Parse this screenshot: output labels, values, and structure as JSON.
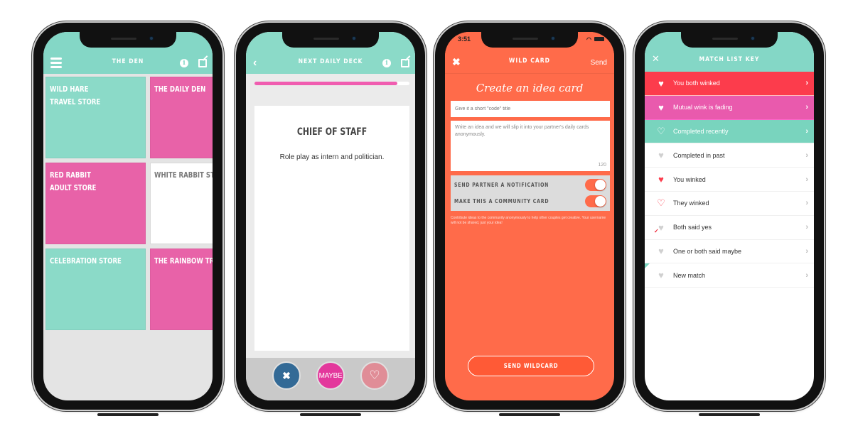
{
  "colors": {
    "teal": "#84d7c6",
    "pink": "#e862a8",
    "coral": "#ff6b4a",
    "red": "#fc3c4c",
    "magenta": "#e95aad",
    "mint": "#79d4be",
    "progress": "#f05db0",
    "no_button": "#336a96",
    "maybe_button": "#e3389c",
    "yes_button": "#e08d97"
  },
  "phone1": {
    "title": "The Den",
    "tiles": [
      {
        "label_lines": [
          "Wild Hare",
          "Travel Store"
        ],
        "color": "teal"
      },
      {
        "label_lines": [
          "The Daily Den"
        ],
        "color": "pink"
      },
      {
        "label_lines": [
          "Red Rabbit",
          "Adult Store"
        ],
        "color": "pink"
      },
      {
        "label_lines": [
          "White Rabbit Store"
        ],
        "color": "white"
      },
      {
        "label_lines": [
          "Celebration Store"
        ],
        "color": "teal"
      },
      {
        "label_lines": [
          "The Rainbow Trail"
        ],
        "color": "pink"
      }
    ]
  },
  "phone2": {
    "title": "Next Daily Deck",
    "progress_percent": 92,
    "card_title": "Chief of Staff",
    "card_text": "Role play as intern and politician.",
    "buttons": {
      "no": "✖",
      "maybe": "MAYBE",
      "yes": "♡"
    }
  },
  "phone3": {
    "status_time": "3:51",
    "title": "Wild Card",
    "send_label": "Send",
    "heading": "Create an idea card",
    "title_placeholder": "Give it a short \"code\" title",
    "idea_placeholder": "Write an idea and we will slip it into your partner's daily cards anonymously.",
    "char_counter": "120",
    "toggles": [
      {
        "label": "Send partner a notification",
        "on": true
      },
      {
        "label": "Make this a community card",
        "on": true
      }
    ],
    "community_note": "Contribute ideas to the community anonymously to help other couples get creative. Your username will not be shared, just your idea!",
    "submit_label": "Send Wildcard"
  },
  "phone4": {
    "title": "Match List Key",
    "items": [
      {
        "label": "You both winked",
        "icon": "♥",
        "style": "red"
      },
      {
        "label": "Mutual wink is fading",
        "icon": "♥",
        "style": "magenta"
      },
      {
        "label": "Completed recently",
        "icon": "♡",
        "style": "mint"
      },
      {
        "label": "Completed in past",
        "icon": "♥",
        "style": "plain-gray"
      },
      {
        "label": "You winked",
        "icon": "♥",
        "style": "plain-red"
      },
      {
        "label": "They winked",
        "icon": "♡",
        "style": "plain-red-outline"
      },
      {
        "label": "Both said yes",
        "icon": "♥",
        "style": "plain-check"
      },
      {
        "label": "One or both said maybe",
        "icon": "♥",
        "style": "plain-gray"
      },
      {
        "label": "New match",
        "icon": "♥",
        "style": "plain-new"
      }
    ]
  }
}
